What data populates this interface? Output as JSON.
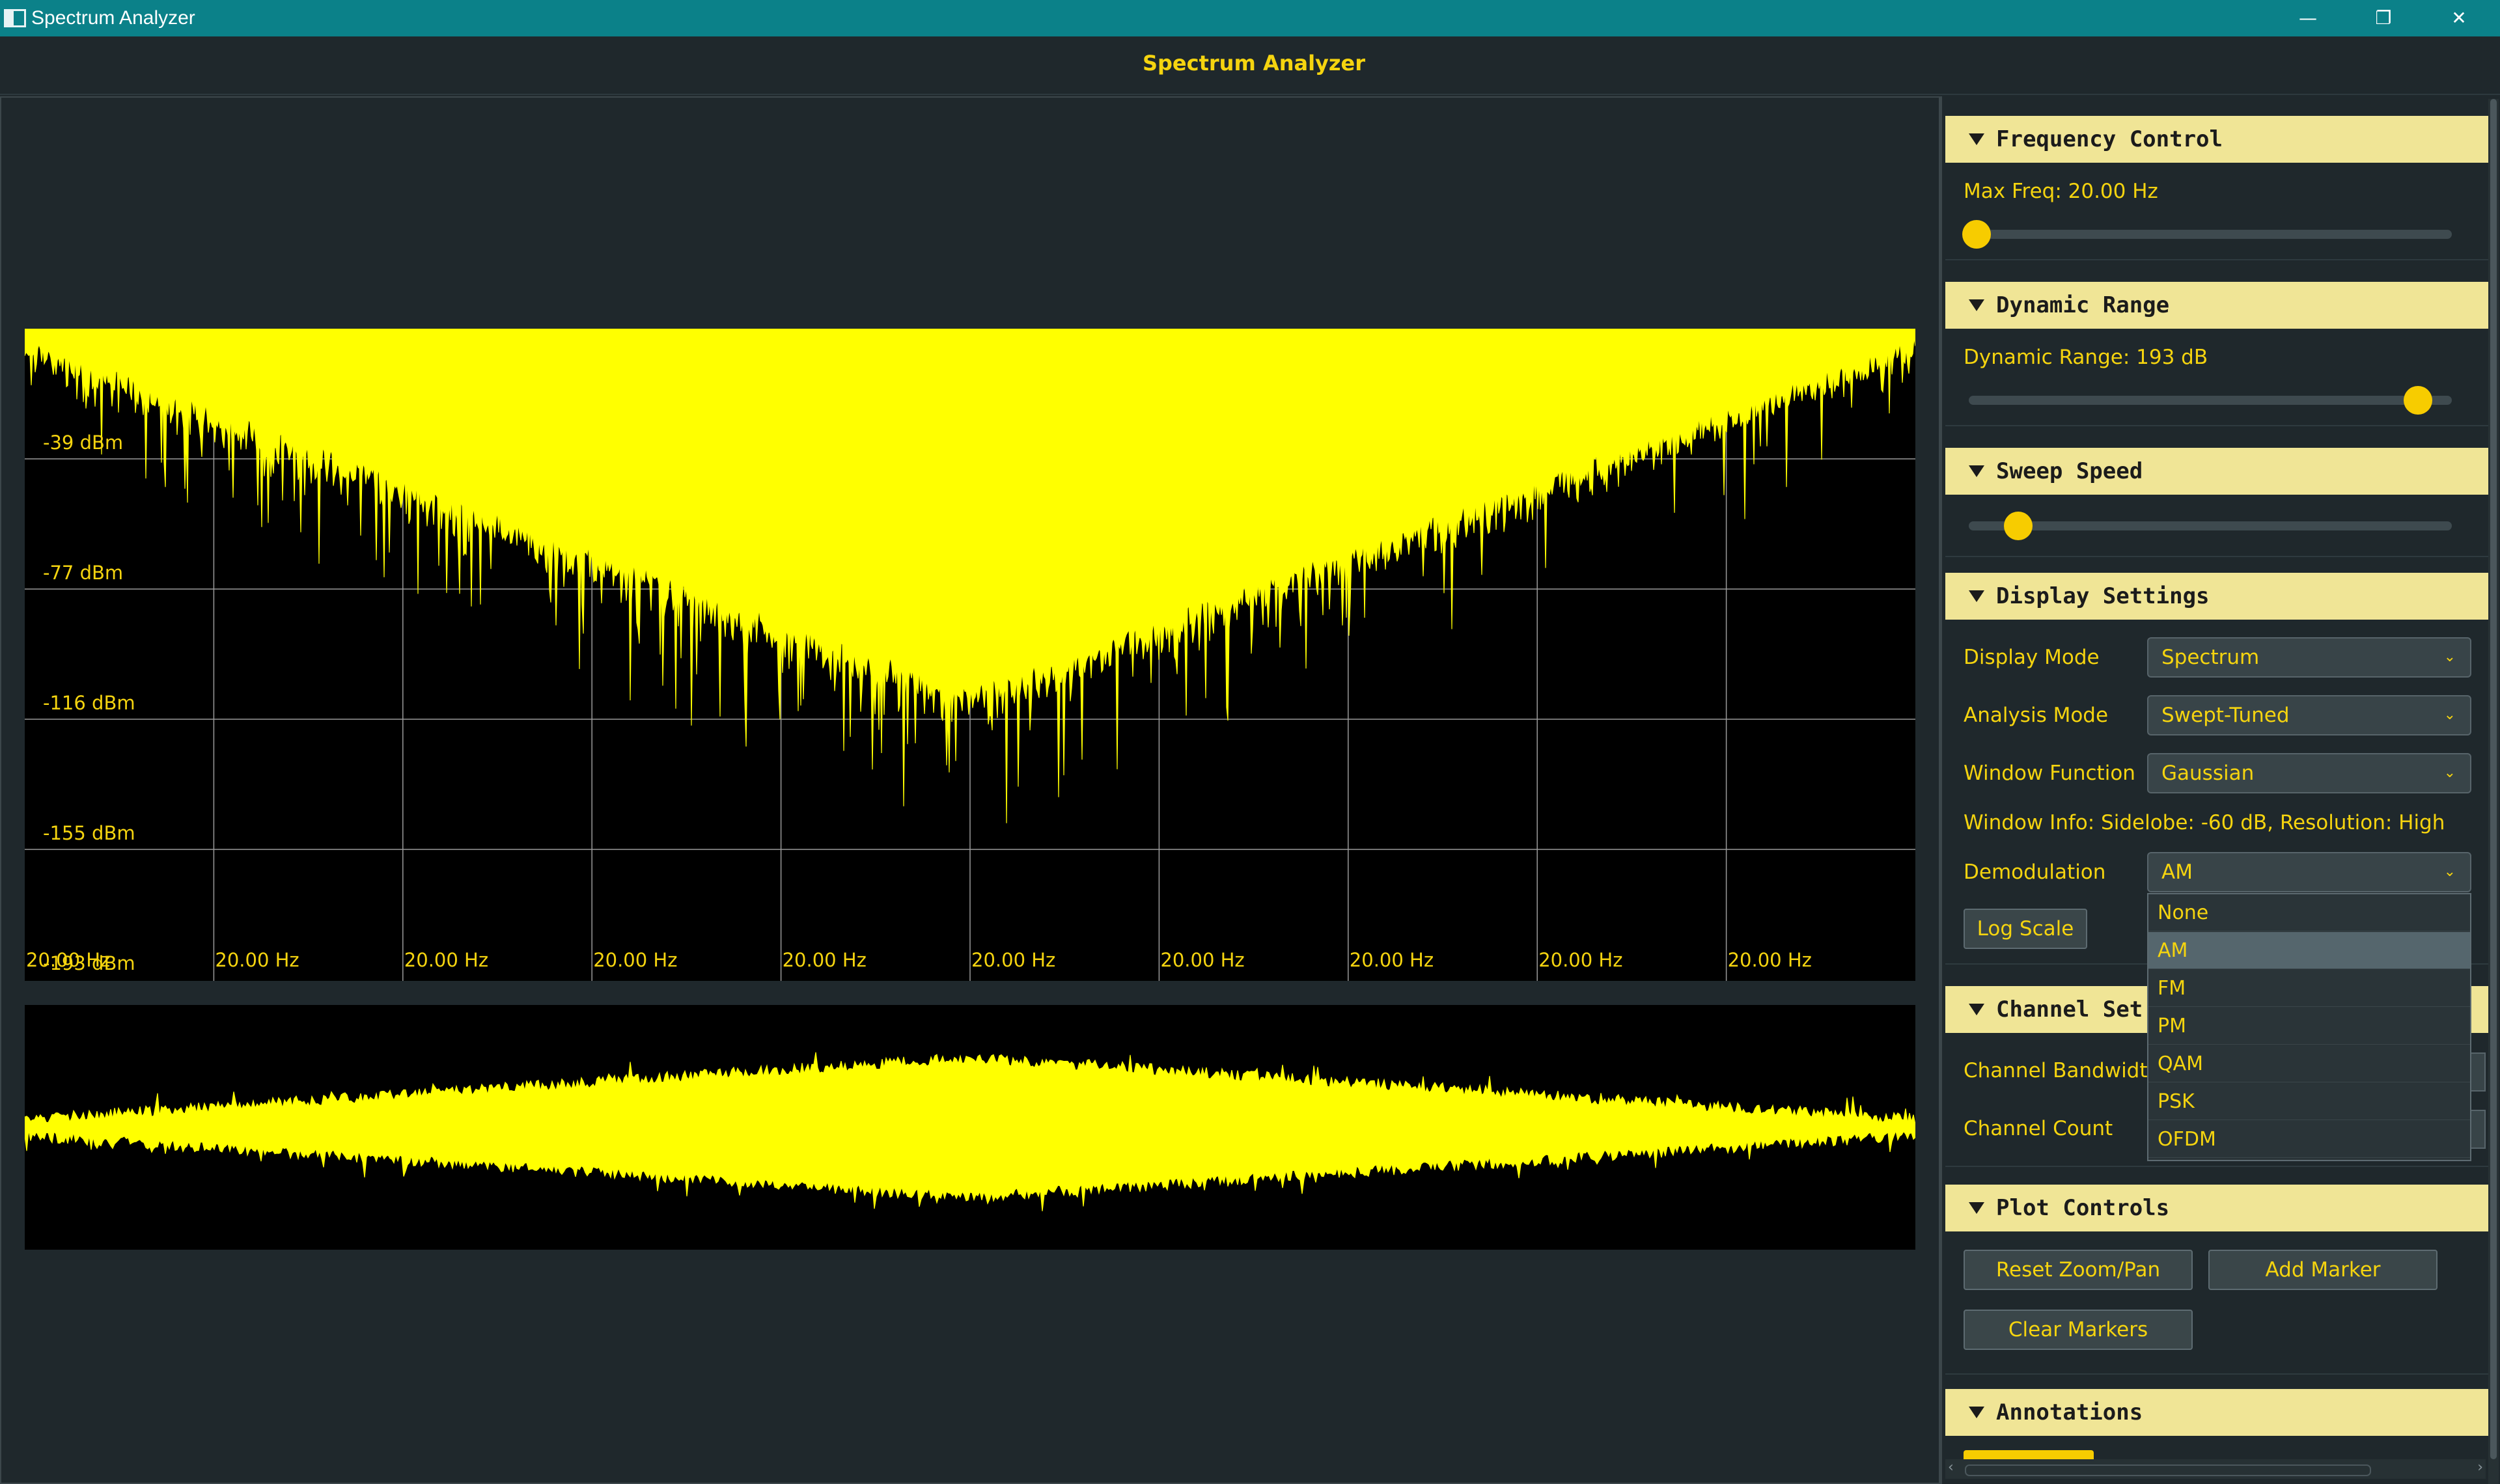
{
  "window": {
    "title": "Spectrum Analyzer",
    "controls": [
      "—",
      "❐",
      "✕"
    ]
  },
  "header": {
    "title": "Spectrum Analyzer"
  },
  "colors": {
    "accent": "#f5d40f",
    "titlebar": "#0b8189",
    "background": "#1f282c",
    "section_header": "#f0e596",
    "plot_bg": "#000000",
    "trace": "#ffff00"
  },
  "spectrum": {
    "y_labels": [
      "-39 dBm",
      "-77 dBm",
      "-116 dBm",
      "-155 dBm",
      "-193 dBm"
    ],
    "x_labels": [
      "20.00 Hz",
      "20.00 Hz",
      "20.00 Hz",
      "20.00 Hz",
      "20.00 Hz",
      "20.00 Hz",
      "20.00 Hz",
      "20.00 Hz",
      "20.00 Hz",
      "20.00 Hz"
    ]
  },
  "panel": {
    "frequency": {
      "title": "Frequency Control",
      "label": "Max Freq: 20.00 Hz",
      "value_fraction": 0.0
    },
    "dynamic": {
      "title": "Dynamic Range",
      "label": "Dynamic Range: 193 dB",
      "value_fraction": 0.91
    },
    "sweep": {
      "title": "Sweep Speed",
      "value_fraction": 0.1
    },
    "display": {
      "title": "Display Settings",
      "display_mode_label": "Display Mode",
      "display_mode": "Spectrum",
      "analysis_mode_label": "Analysis Mode",
      "analysis_mode": "Swept-Tuned",
      "window_function_label": "Window Function",
      "window_function": "Gaussian",
      "window_info": "Window Info: Sidelobe: -60 dB, Resolution: High",
      "demodulation_label": "Demodulation",
      "demodulation": "AM",
      "demodulation_options": [
        "None",
        "AM",
        "FM",
        "PM",
        "QAM",
        "PSK",
        "OFDM"
      ],
      "log_scale_button": "Log Scale"
    },
    "channel": {
      "title": "Channel Settings",
      "title_visible": "Channel Set",
      "bandwidth_label": "Channel Bandwidth",
      "count_label": "Channel Count"
    },
    "plot_controls": {
      "title": "Plot Controls",
      "reset_button": "Reset Zoom/Pan",
      "marker_button": "Add Marker",
      "clear_button": "Clear Markers"
    },
    "annotations": {
      "title": "Annotations"
    }
  }
}
